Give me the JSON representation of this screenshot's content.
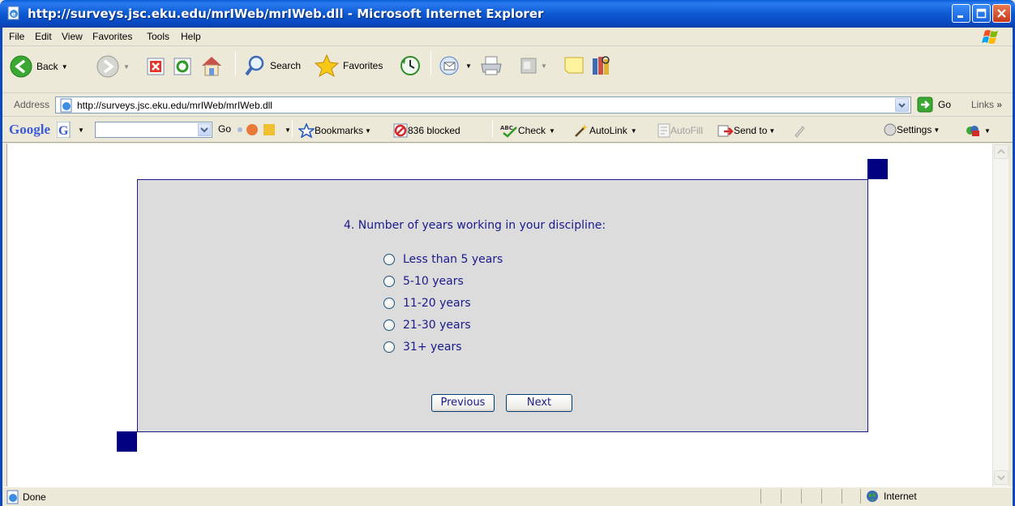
{
  "window": {
    "title": "http://surveys.jsc.eku.edu/mrIWeb/mrIWeb.dll - Microsoft Internet Explorer"
  },
  "menu": {
    "items": [
      "File",
      "Edit",
      "View",
      "Favorites",
      "Tools",
      "Help"
    ]
  },
  "toolbar": {
    "back_label": "Back",
    "search_label": "Search",
    "favorites_label": "Favorites"
  },
  "address": {
    "label": "Address",
    "url": "http://surveys.jsc.eku.edu/mrIWeb/mrIWeb.dll",
    "go_label": "Go",
    "links_label": "Links"
  },
  "googlebar": {
    "brand": "Google",
    "go_label": "Go",
    "bookmarks_label": "Bookmarks",
    "blocked_label": "836 blocked",
    "check_label": "Check",
    "autolink_label": "AutoLink",
    "autofill_label": "AutoFill",
    "sendto_label": "Send to",
    "settings_label": "Settings"
  },
  "survey": {
    "question": "4. Number of years working in your discipline:",
    "options": [
      "Less than 5 years",
      "5-10 years",
      "11-20 years",
      "21-30 years",
      "31+ years"
    ],
    "previous_label": "Previous",
    "next_label": "Next"
  },
  "status": {
    "text": "Done",
    "zone": "Internet"
  },
  "colors": {
    "survey_text": "#1a1a8c",
    "panel_bg": "#dcdcdc",
    "corner": "#000080",
    "titlebar": "#0a5fd6"
  }
}
